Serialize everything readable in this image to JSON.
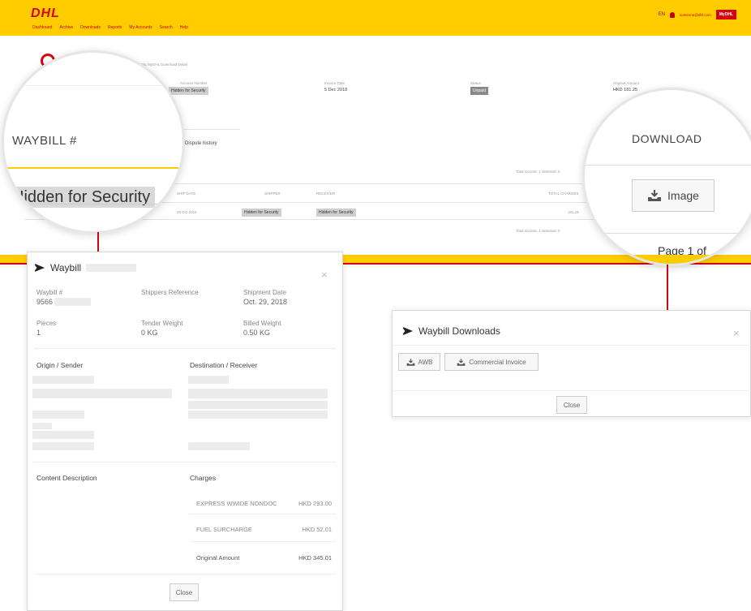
{
  "portal": {
    "logo": "DHL",
    "nav": [
      "Dashboard",
      "Archive",
      "Downloads",
      "Reports",
      "My Accounts",
      "Search",
      "Help"
    ],
    "language": "EN",
    "user_email": "someone@dhl.com",
    "mydhl_label": "MyDHL",
    "breadcrumb_note": "DHL MyDHL Download Detail",
    "invoice_number_label": "Account Number",
    "invoice_number_value": "Hidden for Security",
    "invoice_date_label": "Invoice Date",
    "invoice_date_value": "5 Dec 2018",
    "status_label": "Status",
    "status_value": "Unpaid",
    "original_amount_label": "Original Amount",
    "original_amount_value": "HKD 181.25",
    "dispute_history": "Dispute history",
    "table_meta": "Total records: 1   Selected: 0",
    "col_shipdate": "SHIP DATE",
    "col_shipper": "SHIPPER",
    "col_receiver": "RECEIVER",
    "col_total": "TOTAL CHARGES",
    "row_date": "29 Oct 2018",
    "row_shipper": "Hidden for Security",
    "row_receiver": "Hidden for Security",
    "row_total": "181.25",
    "table_meta_bottom": "Total records: 1   Selected: 0"
  },
  "magnifier_left": {
    "header": "WAYBILL #",
    "cell": "Hidden for Security"
  },
  "magnifier_right": {
    "header": "DOWNLOAD",
    "button": "Image",
    "page": "Page 1 of"
  },
  "waybill_modal": {
    "title": "Waybill",
    "waybill_label": "Waybill #",
    "waybill_value": "9566",
    "shippers_ref_label": "Shippers Reference",
    "shipment_date_label": "Shipment Date",
    "shipment_date_value": "Oct. 29, 2018",
    "pieces_label": "Pieces",
    "pieces_value": "1",
    "tender_weight_label": "Tender Weight",
    "tender_weight_value": "0 KG",
    "billed_weight_label": "Billed Weight",
    "billed_weight_value": "0.50 KG",
    "origin_heading": "Origin / Sender",
    "destination_heading": "Destination / Receiver",
    "content_heading": "Content Description",
    "charges_heading": "Charges",
    "charges": [
      {
        "label": "EXPRESS WWIDE NONDOC",
        "value": "HKD 293.00"
      },
      {
        "label": "FUEL SURCHARGE",
        "value": "HKD 52.01"
      }
    ],
    "original_amount_label": "Original Amount",
    "original_amount_value": "HKD 345.01",
    "close_label": "Close"
  },
  "downloads_modal": {
    "title": "Waybill Downloads",
    "buttons": [
      "AWB",
      "Commercial Invoice"
    ],
    "close_label": "Close"
  },
  "colors": {
    "dhl_yellow": "#ffcc00",
    "dhl_red": "#d40511"
  }
}
